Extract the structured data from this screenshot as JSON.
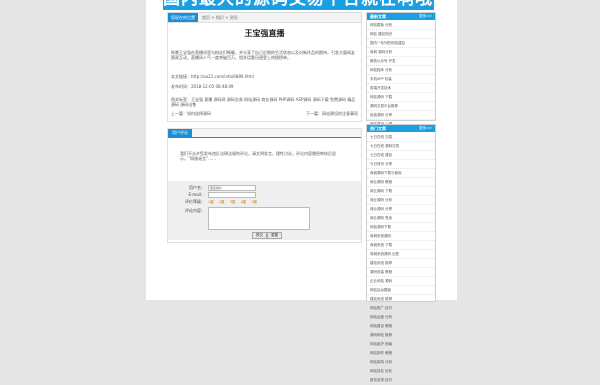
{
  "banner": {
    "text": "国内最大的源码交易平台就在啊哦源码网"
  },
  "breadcrumb": {
    "tab": "您现在的位置",
    "path": "首页 > 知识 > 资讯"
  },
  "article": {
    "title": "王宝强直播",
    "body": "昨晚王宝强在直播间里与粉丝们畅聊，并分享了自己近期的生活状态以及对新作品的期待，引发大量网友围观互动，直播间人气一度突破百万，相关话题迅速登上热搜榜单。",
    "link": "本文链接：http://ao21.com/info/6889.html",
    "date": "发布时间：2018-12-05 08:48:49",
    "tags": "相关标签：王宝强 直播 源码网 源码交易 网站源码 商业源码 PHP源码 ASP源码 源码下载 免费源码 精品源码 源码出售",
    "prev": "上一篇：如何选择源码",
    "next": "下一篇：网站建设的注意事项"
  },
  "comment": {
    "tab": "用户评论",
    "notice": "我们不允许您发布违反法律法规的评论，请文明发言，理性讨论，评论内容需经审核后显示。“网络谣言”……",
    "name_label": "用户名：",
    "name_value": "匿名用户",
    "email_label": "E-mail：",
    "rating_label": "评价等级：",
    "ratings": [
      "1星",
      "2星",
      "3星",
      "4星",
      "5星"
    ],
    "content_label": "评论内容：",
    "submit_label": "提交",
    "reset_label": "重置"
  },
  "sidebar": {
    "latest": {
      "title": "最新文章",
      "more": "更多>>",
      "items": [
        "网站模板 分析",
        "网站 建站知识",
        "国内一系列的网站建站",
        "商城 源码分析",
        "微信公众号 开发",
        "网站程序 分析",
        "手机APP 包装",
        "前端开发技术",
        "网站源码 下载",
        "源码交易平台推荐",
        "免费源码 分享",
        "网站建设 心得",
        "网站建站优化",
        "网站交易 注意"
      ]
    },
    "hot": {
      "title": "热门文章",
      "more": "更多>>",
      "items": [
        "七日在线 交易",
        "七日在线 源码交易",
        "七日在线 建站",
        "今日快讯 分享",
        "商城源码下载与使用",
        "商业源码 教程",
        "商业源码 下载",
        "商业源码 分析",
        "商业源码 分享",
        "商业源码 售卖",
        "网站源码下载",
        "商城系统源码",
        "商城系统 下载",
        "商城系统源码 出售",
        "建站系统 推荐",
        "源码安装 教程",
        "企业网站 源码",
        "网站后台模板",
        "建站系统 推荐",
        "网站推广 技巧",
        "网站运营 分析",
        "网站建设 教程",
        "源码网站 推荐",
        "网站维护 指南",
        "网站制作 教程",
        "网站架构 分析",
        "网站排名 优化",
        "新站收录 技巧"
      ]
    }
  }
}
